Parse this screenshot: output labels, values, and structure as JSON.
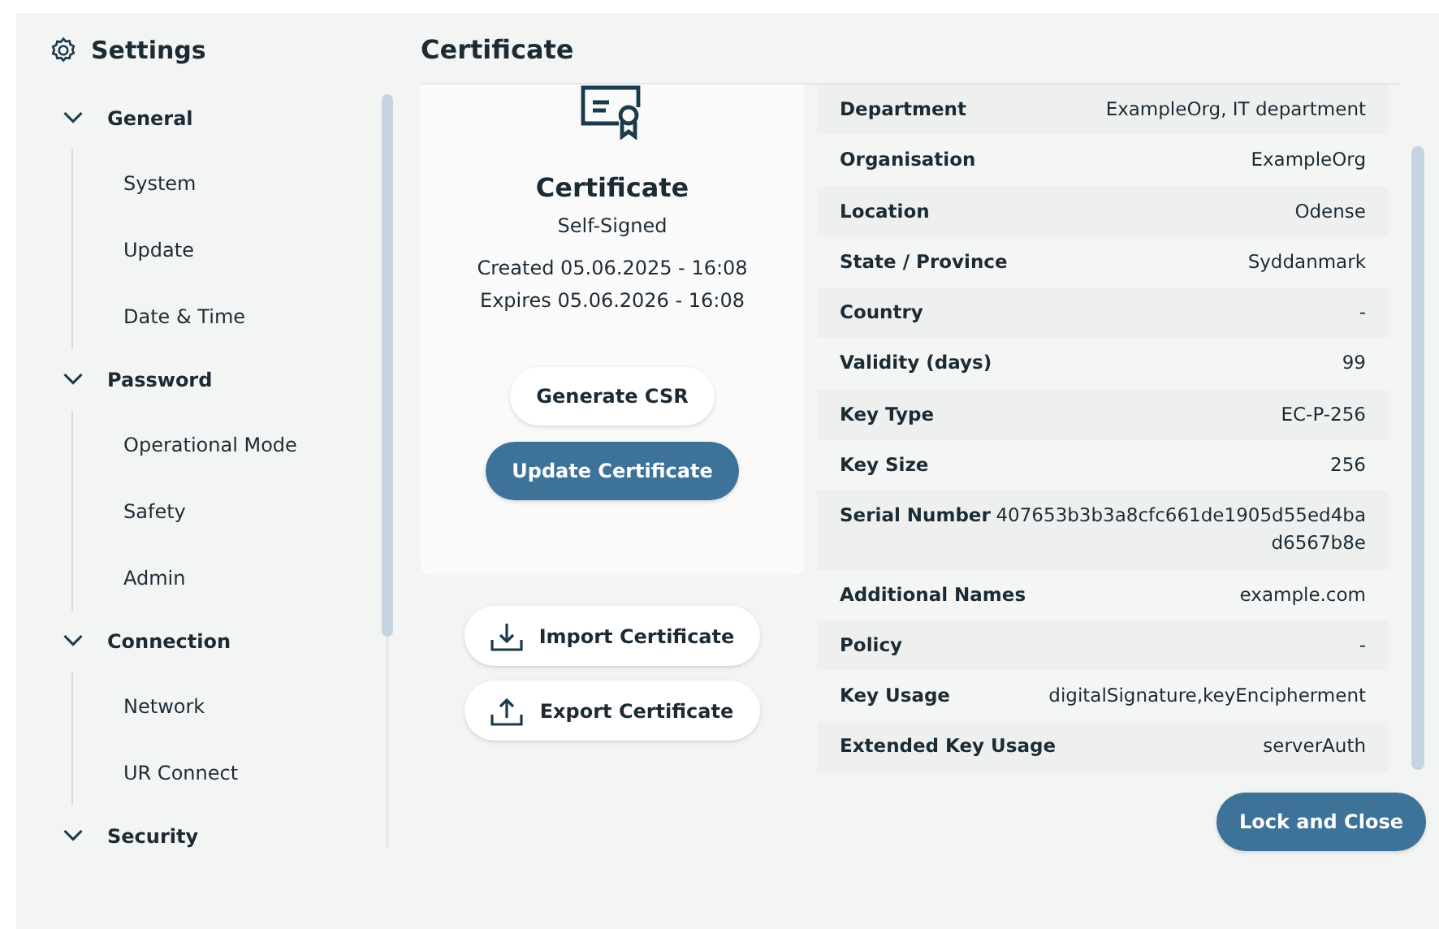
{
  "window": {
    "title": "Settings"
  },
  "sidebar": {
    "groups": [
      {
        "label": "General",
        "expanded": true,
        "children": [
          {
            "label": "System"
          },
          {
            "label": "Update"
          },
          {
            "label": "Date & Time"
          }
        ]
      },
      {
        "label": "Password",
        "expanded": true,
        "children": [
          {
            "label": "Operational Mode"
          },
          {
            "label": "Safety"
          },
          {
            "label": "Admin"
          }
        ]
      },
      {
        "label": "Connection",
        "expanded": true,
        "children": [
          {
            "label": "Network"
          },
          {
            "label": "UR Connect"
          }
        ]
      },
      {
        "label": "Security",
        "expanded": true
      }
    ]
  },
  "page_title": "Certificate",
  "certificate_card": {
    "title": "Certificate",
    "subtitle": "Self-Signed",
    "created": "Created 05.06.2025 - 16:08",
    "expires": "Expires 05.06.2026 - 16:08",
    "buttons": [
      {
        "label": "Generate CSR",
        "kind": "secondary"
      },
      {
        "label": "Update Certificate",
        "kind": "primary"
      }
    ]
  },
  "file_buttons": [
    {
      "label": "Import Certificate",
      "kind": "import"
    },
    {
      "label": "Export Certificate",
      "kind": "export"
    }
  ],
  "details": [
    {
      "label": "Department",
      "value": "ExampleOrg, IT department"
    },
    {
      "label": "Organisation",
      "value": "ExampleOrg"
    },
    {
      "label": "Location",
      "value": "Odense"
    },
    {
      "label": "State / Province",
      "value": "Syddanmark"
    },
    {
      "label": "Country",
      "value": "-"
    },
    {
      "label": "Validity (days)",
      "value": "99"
    },
    {
      "label": "Key Type",
      "value": "EC-P-256"
    },
    {
      "label": "Key Size",
      "value": "256"
    },
    {
      "label": "Serial Number",
      "value": "407653b3b3a8cfc661de1905d55ed4bad6567b8e"
    },
    {
      "label": "Additional Names",
      "value": "example.com"
    },
    {
      "label": "Policy",
      "value": "-"
    },
    {
      "label": "Key Usage",
      "value": "digitalSignature,keyEncipherment"
    },
    {
      "label": "Extended Key Usage",
      "value": "serverAuth"
    }
  ],
  "footer_button": "Lock and Close"
}
